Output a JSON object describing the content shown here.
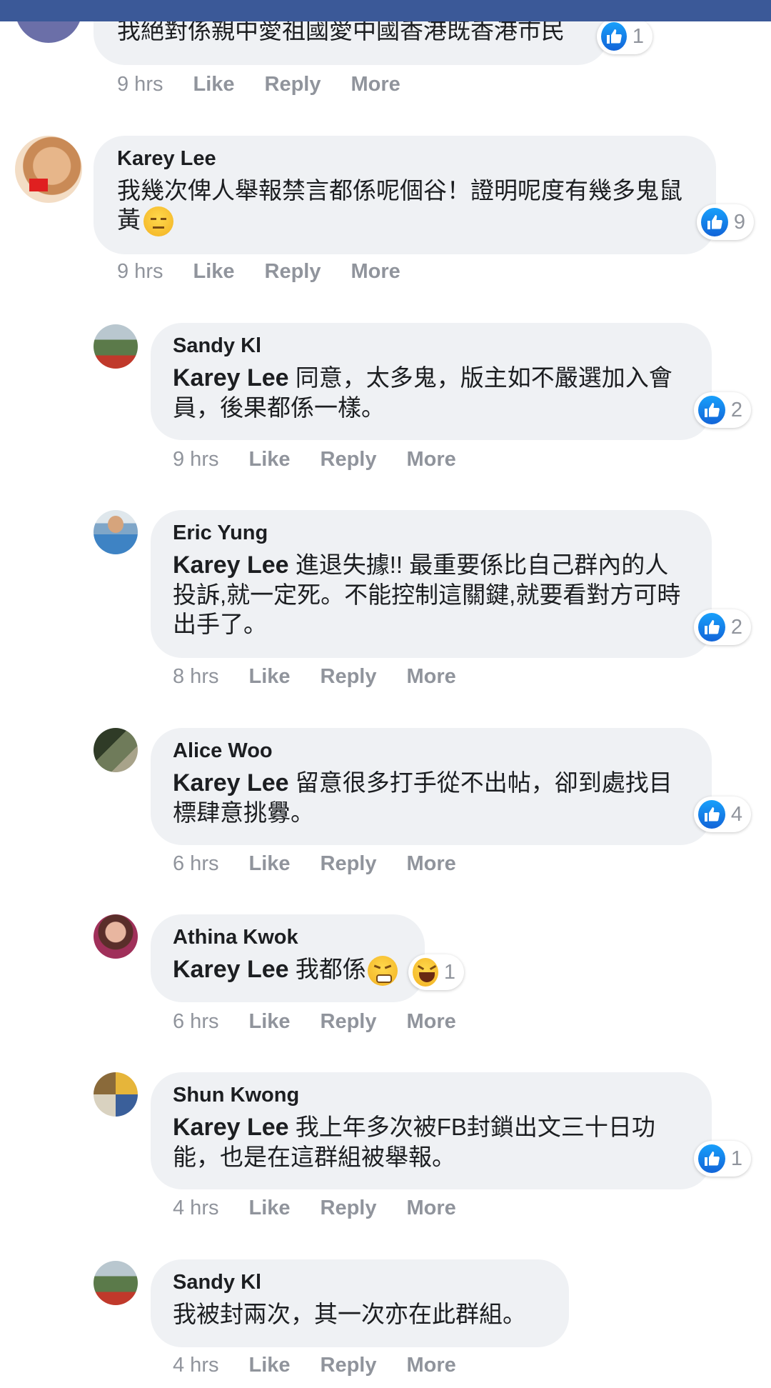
{
  "comments": [
    {
      "author": "",
      "text": "我絕對係親中愛祖國愛中國香港既香港市民",
      "reactions": "1",
      "time": "9 hrs"
    },
    {
      "author": "Karey Lee",
      "text": "我幾次俾人舉報禁言都係呢個谷！證明呢度有幾多鬼鼠黃",
      "reactions": "9",
      "time": "9 hrs"
    },
    {
      "author": "Sandy Kl",
      "mention": "Karey Lee",
      "text": " 同意，太多鬼，版主如不嚴選加入會員，後果都係一樣。",
      "reactions": "2",
      "time": "9 hrs"
    },
    {
      "author": "Eric Yung",
      "mention": "Karey Lee",
      "text": " 進退失據!! 最重要係比自己群內的人投訴,就一定死。不能控制這關鍵,就要看對方可時出手了。",
      "reactions": "2",
      "time": "8 hrs"
    },
    {
      "author": "Alice Woo",
      "mention": "Karey Lee",
      "text": " 留意很多打手從不出帖，卻到處找目標肆意挑釁。",
      "reactions": "4",
      "time": "6 hrs"
    },
    {
      "author": "Athina Kwok",
      "mention": "Karey Lee",
      "text": " 我都係",
      "reactions": "1",
      "time": "6 hrs"
    },
    {
      "author": "Shun Kwong",
      "mention": "Karey Lee",
      "text": " 我上年多次被FB封鎖出文三十日功能，也是在這群組被舉報。",
      "reactions": "1",
      "time": "4 hrs"
    },
    {
      "author": "Sandy Kl",
      "text": "我被封兩次，其一次亦在此群組。",
      "time": "4 hrs"
    }
  ],
  "actions": {
    "like": "Like",
    "reply": "Reply",
    "more": "More"
  },
  "colors": {
    "bubble": "#eff1f4",
    "meta_text": "#90949c",
    "like_blue": "#1877f2",
    "top_bar": "#3b5998"
  },
  "icons": {
    "like": "thumbs-up-icon",
    "angry_face": "pouting-face-emoji",
    "laugh": "laughing-face-emoji",
    "unamused": "expressionless-face-emoji"
  }
}
